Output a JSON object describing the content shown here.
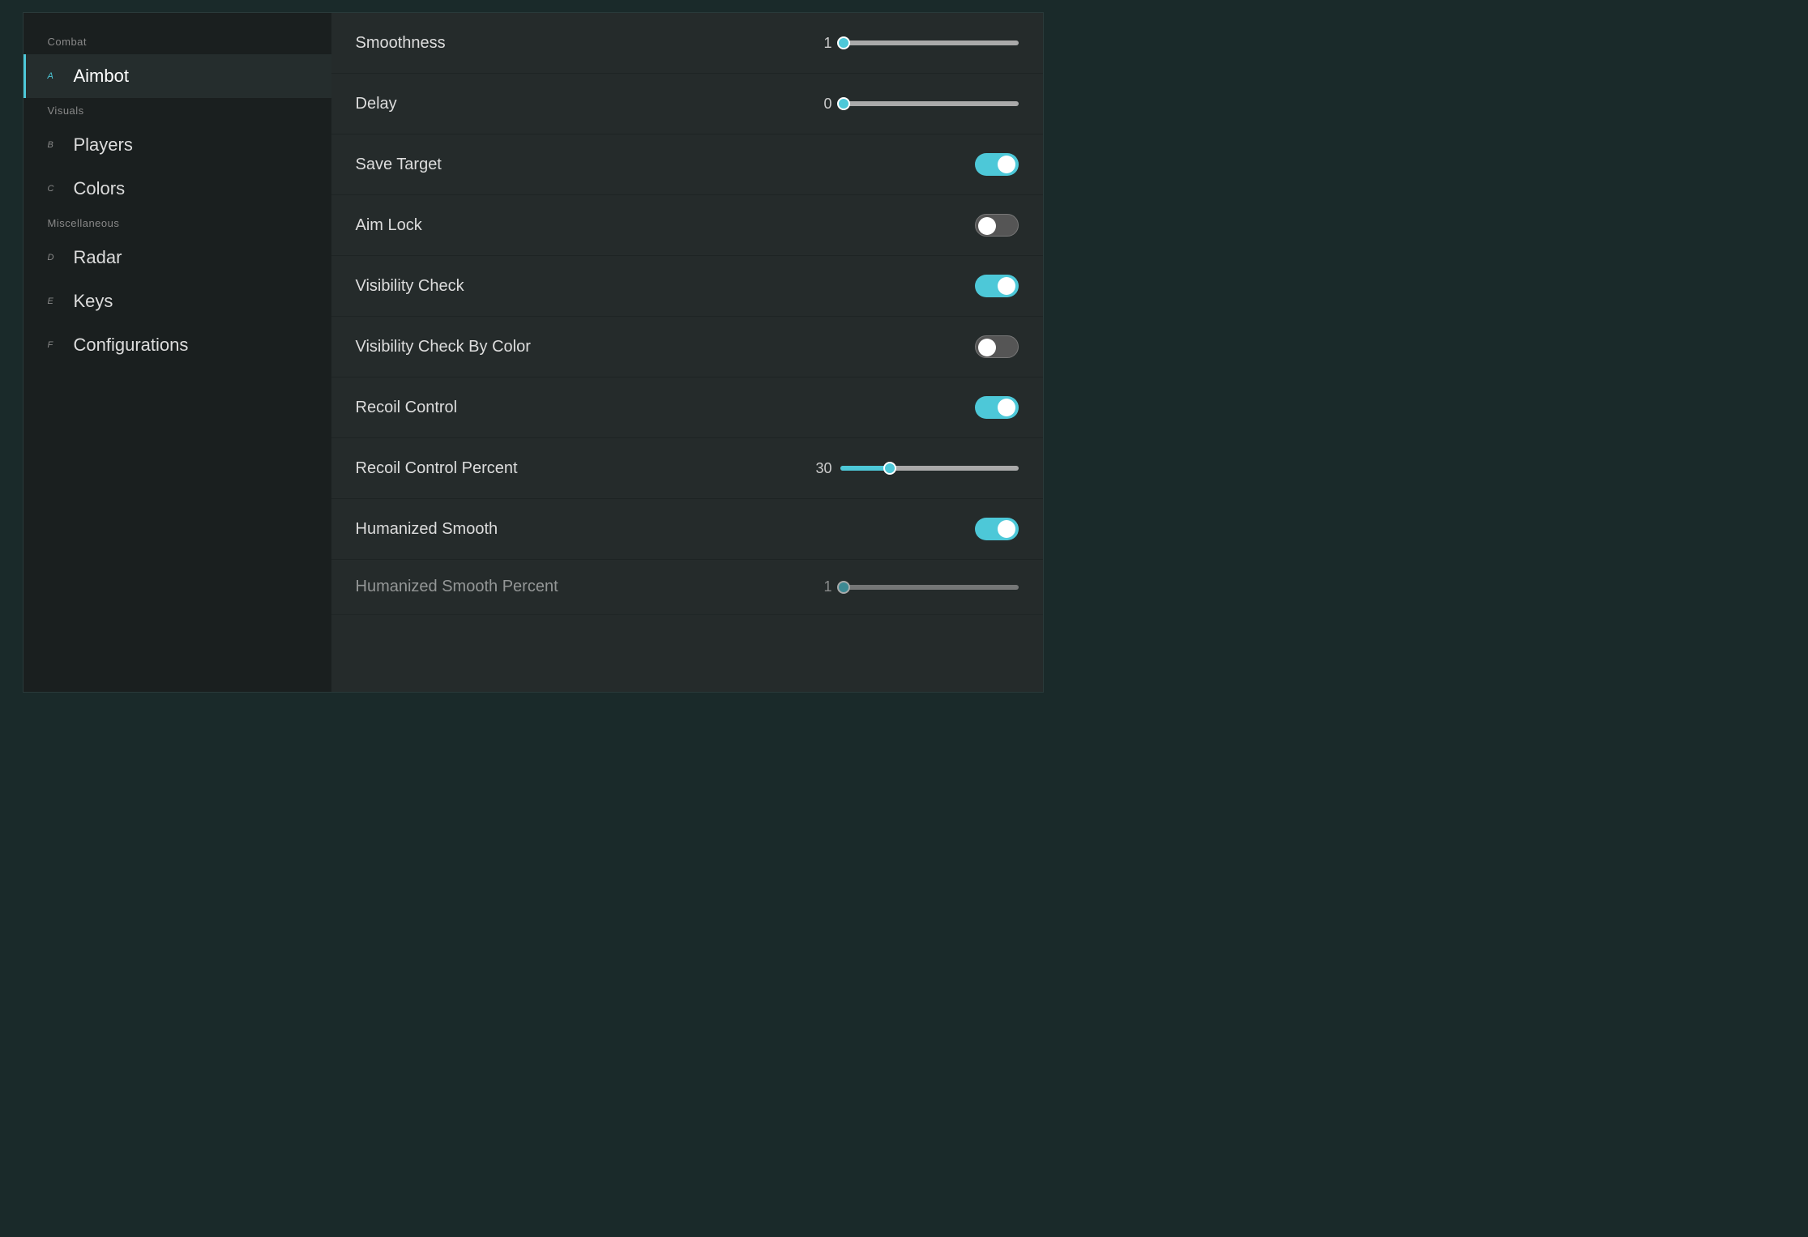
{
  "sidebar": {
    "sections": [
      {
        "label": "Combat",
        "items": [
          {
            "key": "A",
            "label": "Aimbot",
            "active": true
          }
        ]
      },
      {
        "label": "Visuals",
        "items": [
          {
            "key": "B",
            "label": "Players",
            "active": false
          },
          {
            "key": "C",
            "label": "Colors",
            "active": false
          }
        ]
      },
      {
        "label": "Miscellaneous",
        "items": [
          {
            "key": "D",
            "label": "Radar",
            "active": false
          },
          {
            "key": "E",
            "label": "Keys",
            "active": false
          },
          {
            "key": "F",
            "label": "Configurations",
            "active": false
          }
        ]
      }
    ]
  },
  "settings": [
    {
      "name": "Smoothness",
      "type": "slider",
      "value": 1,
      "percent": 2
    },
    {
      "name": "Delay",
      "type": "slider",
      "value": 0,
      "percent": 2
    },
    {
      "name": "Save Target",
      "type": "toggle",
      "enabled": true
    },
    {
      "name": "Aim Lock",
      "type": "toggle",
      "enabled": false
    },
    {
      "name": "Visibility Check",
      "type": "toggle",
      "enabled": true
    },
    {
      "name": "Visibility Check By Color",
      "type": "toggle",
      "enabled": false
    },
    {
      "name": "Recoil Control",
      "type": "toggle",
      "enabled": true
    },
    {
      "name": "Recoil Control Percent",
      "type": "slider",
      "value": 30,
      "percent": 28
    },
    {
      "name": "Humanized Smooth",
      "type": "toggle",
      "enabled": true
    },
    {
      "name": "Humanized Smooth Percent",
      "type": "slider",
      "value": 1,
      "percent": 2,
      "partial": true
    }
  ]
}
